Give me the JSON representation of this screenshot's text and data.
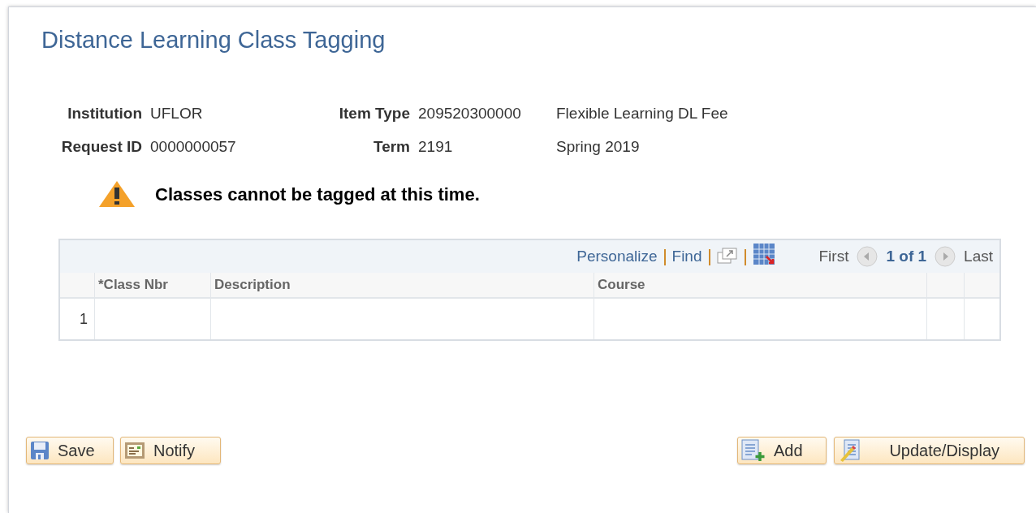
{
  "page": {
    "title": "Distance Learning Class Tagging"
  },
  "fields": [
    {
      "label": "Institution",
      "value": "UFLOR"
    },
    {
      "label": "Item Type",
      "value": "209520300000",
      "extra": "Flexible Learning DL Fee"
    },
    {
      "label": "Request ID",
      "value": "0000000057"
    },
    {
      "label": "Term",
      "value": "2191",
      "extra": "Spring 2019"
    }
  ],
  "warning": {
    "message": "Classes cannot be tagged at this time."
  },
  "grid": {
    "toolbar": {
      "links": [
        "Personalize",
        "Find"
      ],
      "first": "First",
      "position": "1 of 1",
      "last": "Last"
    },
    "columns": [
      "*Class Nbr",
      "Description",
      "Course"
    ],
    "rows": [
      {
        "number": "1"
      }
    ]
  },
  "left_buttons": [
    {
      "label": "Save",
      "kind": "save"
    },
    {
      "label": "Notify",
      "kind": "notify"
    }
  ],
  "right_buttons": [
    {
      "label": "Add",
      "kind": "add"
    },
    {
      "label": "Update/Display",
      "kind": "update"
    }
  ]
}
